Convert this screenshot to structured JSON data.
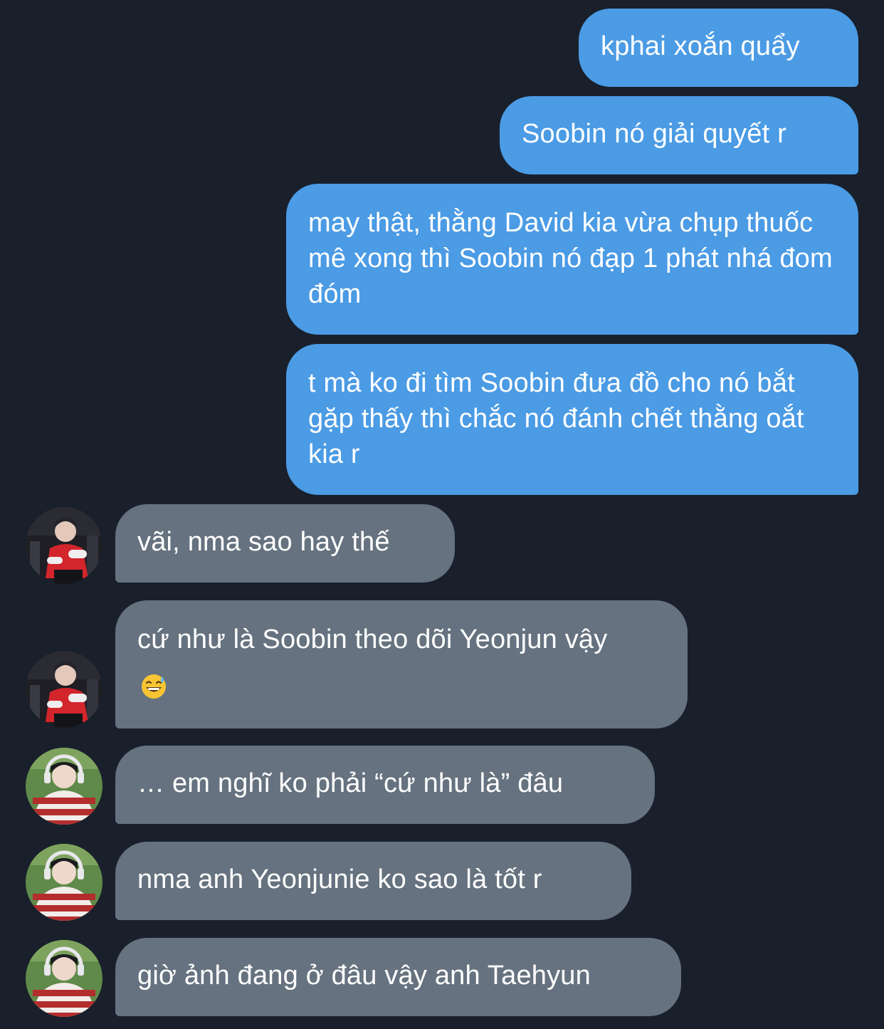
{
  "colors": {
    "background": "#19202b",
    "outgoing_bubble": "#4b9be5",
    "incoming_bubble": "#66727f",
    "text": "#ffffff"
  },
  "messages": [
    {
      "direction": "outgoing",
      "text": "kphai xoắn quẩy"
    },
    {
      "direction": "outgoing",
      "text": "Soobin nó giải quyết r"
    },
    {
      "direction": "outgoing",
      "text": "may thật, thằng David kia vừa chụp thuốc mê xong thì Soobin nó đạp 1 phát nhá đom đóm"
    },
    {
      "direction": "outgoing",
      "text": "t mà ko đi tìm Soobin đưa đồ cho nó bắt gặp thấy thì chắc nó đánh chết thằng oắt kia r"
    },
    {
      "direction": "incoming",
      "sender_avatar": "avatar-red-jacket",
      "text": "vãi, nma sao hay thế"
    },
    {
      "direction": "incoming",
      "sender_avatar": "avatar-red-jacket",
      "text": "cứ như là Soobin theo dõi Yeonjun vậy",
      "emoji": "grinning-sweat-emoji"
    },
    {
      "direction": "incoming",
      "sender_avatar": "avatar-striped-sweater",
      "text": "… em nghĩ ko phải “cứ như là” đâu"
    },
    {
      "direction": "incoming",
      "sender_avatar": "avatar-striped-sweater",
      "text": "nma anh Yeonjunie ko sao là tốt r"
    },
    {
      "direction": "incoming",
      "sender_avatar": "avatar-striped-sweater",
      "text": "giờ ảnh đang ở đâu vậy anh Taehyun"
    }
  ]
}
